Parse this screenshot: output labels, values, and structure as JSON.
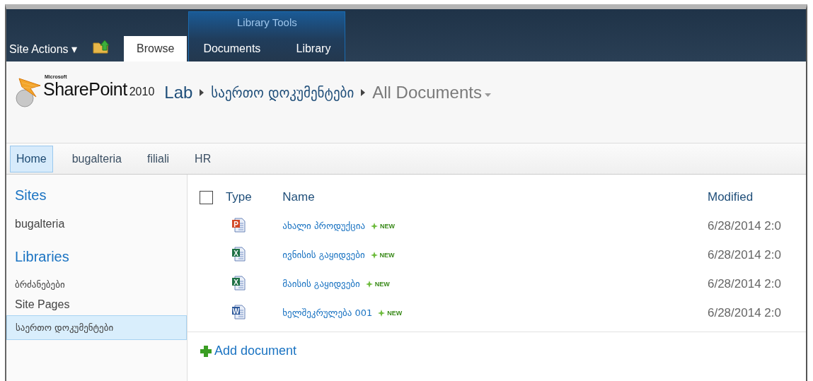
{
  "ribbon": {
    "site_actions": "Site Actions ▾",
    "context_group": "Library Tools",
    "tabs": [
      {
        "label": "Browse",
        "selected": true,
        "contextual": false
      },
      {
        "label": "Documents",
        "selected": false,
        "contextual": true
      },
      {
        "label": "Library",
        "selected": false,
        "contextual": true
      }
    ]
  },
  "header": {
    "logo": {
      "company": "Microsoft",
      "product": "SharePoint",
      "version": "2010"
    },
    "breadcrumb": [
      {
        "label": "Lab",
        "kind": "site"
      },
      {
        "label": "საერთო დოკუმენტები",
        "kind": "library"
      },
      {
        "label": "All Documents",
        "kind": "view"
      }
    ]
  },
  "top_nav": [
    {
      "label": "Home",
      "selected": true
    },
    {
      "label": "bugalteria",
      "selected": false
    },
    {
      "label": "filiali",
      "selected": false
    },
    {
      "label": "HR",
      "selected": false
    }
  ],
  "sidebar": {
    "sections": [
      {
        "title": "Sites",
        "items": [
          {
            "label": "bugalteria",
            "selected": false
          }
        ]
      },
      {
        "title": "Libraries",
        "items": [
          {
            "label": "ბრძანებები",
            "selected": false
          },
          {
            "label": "Site Pages",
            "selected": false
          },
          {
            "label": "საერთო დოკუმენტები",
            "selected": true
          }
        ]
      }
    ]
  },
  "table": {
    "select_all": {
      "checked": false
    },
    "columns": [
      "Type",
      "Name",
      "Modified"
    ],
    "rows": [
      {
        "kind": "powerpoint",
        "icon_text": "P",
        "name": "ახალი პროდუქცია",
        "badge": "NEW",
        "modified": "6/28/2014 2:0"
      },
      {
        "kind": "excel",
        "icon_text": "X",
        "name": "ივნისის გაყიდვები",
        "badge": "NEW",
        "modified": "6/28/2014 2:0"
      },
      {
        "kind": "excel",
        "icon_text": "X",
        "name": "მაისის გაყიდვები",
        "badge": "NEW",
        "modified": "6/28/2014 2:0"
      },
      {
        "kind": "word",
        "icon_text": "W",
        "name": "ხელშეკრულება 001",
        "badge": "NEW",
        "modified": "6/28/2014 2:0"
      }
    ],
    "add_link": "Add document"
  }
}
